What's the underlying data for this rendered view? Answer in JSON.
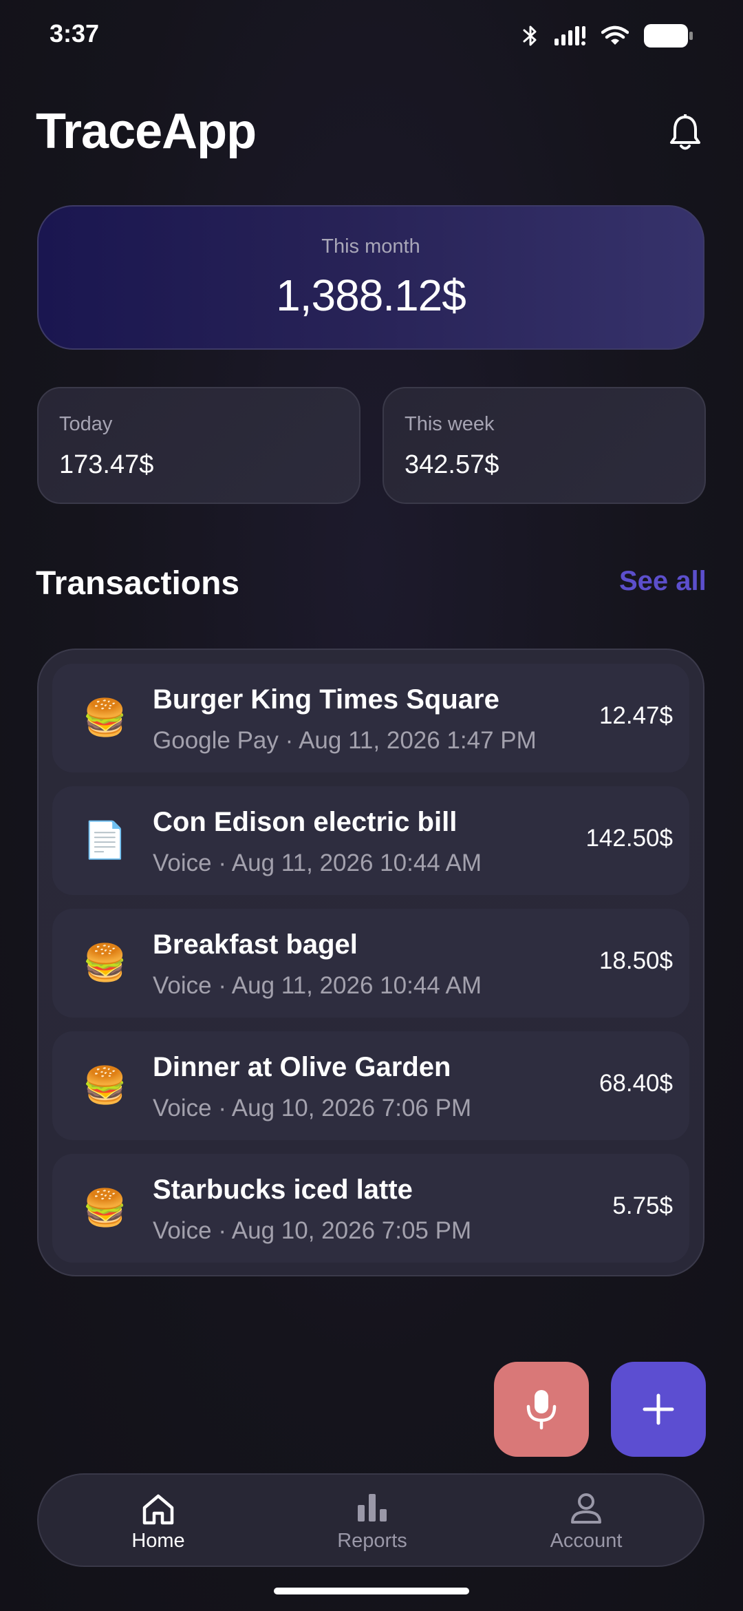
{
  "status_bar": {
    "time": "3:37",
    "icons": [
      "bluetooth-icon",
      "signal-icon",
      "wifi-icon",
      "battery-icon"
    ]
  },
  "header": {
    "title": "TraceApp",
    "notification_icon": "bell-icon"
  },
  "summary": {
    "month_label": "This month",
    "month_value": "1,388.12$",
    "today_label": "Today",
    "today_value": "173.47$",
    "week_label": "This week",
    "week_value": "342.57$"
  },
  "transactions": {
    "title": "Transactions",
    "see_all_label": "See all",
    "items": [
      {
        "emoji": "🍔",
        "title": "Burger King Times Square",
        "meta": "Google Pay · Aug 11, 2026 1:47 PM",
        "amount": "12.47$"
      },
      {
        "emoji": "📄",
        "title": "Con Edison electric bill",
        "meta": "Voice · Aug 11, 2026 10:44 AM",
        "amount": "142.50$"
      },
      {
        "emoji": "🍔",
        "title": "Breakfast bagel",
        "meta": "Voice · Aug 11, 2026 10:44 AM",
        "amount": "18.50$"
      },
      {
        "emoji": "🍔",
        "title": "Dinner at Olive Garden",
        "meta": "Voice · Aug 10, 2026 7:06 PM",
        "amount": "68.40$"
      },
      {
        "emoji": "🍔",
        "title": "Starbucks iced latte",
        "meta": "Voice · Aug 10, 2026 7:05 PM",
        "amount": "5.75$"
      }
    ]
  },
  "actions": {
    "mic_icon": "microphone-icon",
    "add_icon": "plus-icon"
  },
  "nav": {
    "items": [
      {
        "label": "Home",
        "icon": "home-icon",
        "active": true
      },
      {
        "label": "Reports",
        "icon": "bar-chart-icon",
        "active": false
      },
      {
        "label": "Account",
        "icon": "person-icon",
        "active": false
      }
    ]
  },
  "colors": {
    "accent": "#5c4ed1",
    "mic_button": "#d97878",
    "background": "#15141c",
    "card": "#2a2938",
    "muted_text": "#a3a1ad"
  }
}
